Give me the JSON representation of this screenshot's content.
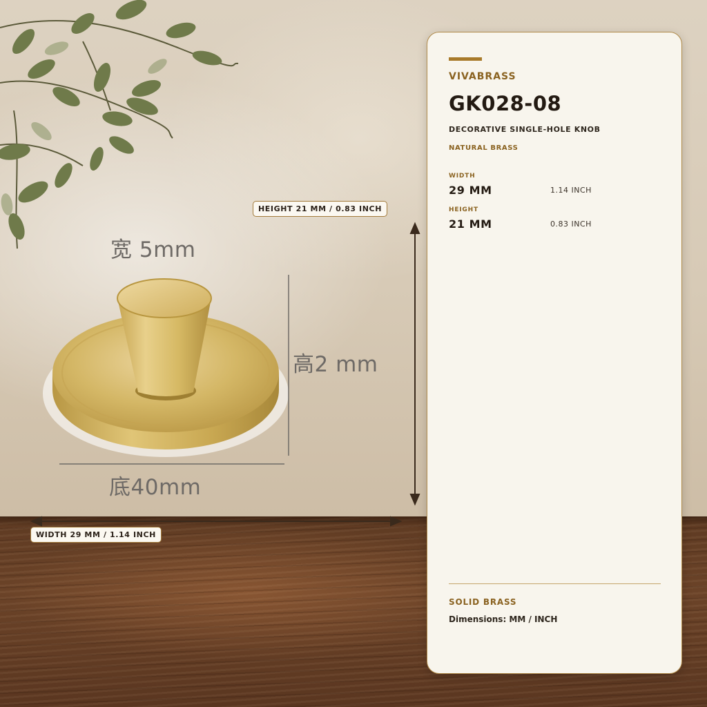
{
  "colors": {
    "accent": "#a87a2a",
    "brass": "#d2b362",
    "panel_bg": "#f8f5ed",
    "text_dark": "#231a12"
  },
  "illustration": {
    "width_cn": "宽  5mm",
    "height_cn": "高2  mm",
    "base_cn": "底40mm"
  },
  "dimension_tags": {
    "height": "HEIGHT  21 MM / 0.83 INCH",
    "width": "WIDTH  29 MM / 1.14 INCH"
  },
  "panel": {
    "brand": "VIVABRASS",
    "model": "GK028-08",
    "description": "DECORATIVE SINGLE-HOLE KNOB",
    "finish": "NATURAL BRASS",
    "specs": {
      "width": {
        "label": "WIDTH",
        "mm": "29 MM",
        "inch": "1.14 INCH"
      },
      "height": {
        "label": "HEIGHT",
        "mm": "21 MM",
        "inch": "0.83 INCH"
      }
    },
    "material": "SOLID BRASS",
    "dimensions_note": "Dimensions: MM / INCH"
  }
}
